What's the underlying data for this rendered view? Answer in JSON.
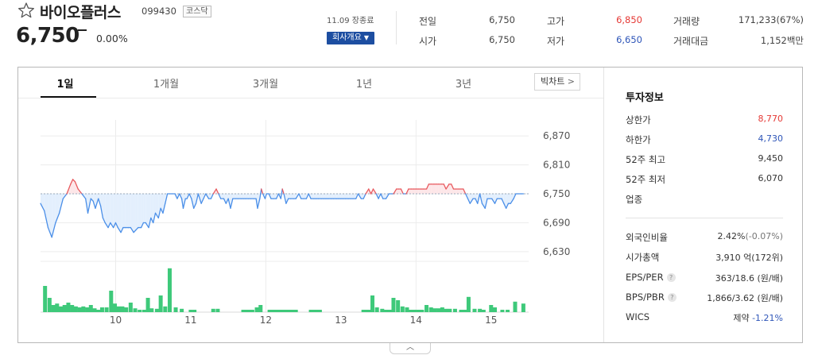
{
  "header": {
    "stock_name": "바이오플러스",
    "stock_code": "099430",
    "market_badge": "코스닥",
    "price": "6,750",
    "change_rate": "0.00%",
    "date_info": "11.09 장종료",
    "company_overview_label": "회사개요"
  },
  "quote": {
    "prev_close_label": "전일",
    "prev_close": "6,750",
    "open_label": "시가",
    "open": "6,750",
    "high_label": "고가",
    "high": "6,850",
    "low_label": "저가",
    "low": "6,650",
    "volume_label": "거래량",
    "volume": "171,233(67%)",
    "amount_label": "거래대금",
    "amount": "1,152백만"
  },
  "tabs": [
    {
      "label": "1일",
      "active": true
    },
    {
      "label": "1개월",
      "active": false
    },
    {
      "label": "3개월",
      "active": false
    },
    {
      "label": "1년",
      "active": false
    },
    {
      "label": "3년",
      "active": false
    }
  ],
  "big_chart_label": "빅차트",
  "chart_data": {
    "type": "line",
    "baseline": 6750,
    "ylim": [
      6620,
      6890
    ],
    "y_ticks": [
      "6,870",
      "6,810",
      "6,750",
      "6,690",
      "6,630"
    ],
    "y_tick_values": [
      6870,
      6810,
      6750,
      6690,
      6630
    ],
    "x_ticks": [
      "10",
      "11",
      "12",
      "13",
      "14",
      "15"
    ],
    "x_tick_hours": [
      10,
      11,
      12,
      13,
      14,
      15
    ],
    "x_range_hours": [
      9.0,
      15.5
    ],
    "x_gridlines_hours": [
      10,
      12,
      14
    ],
    "price_series": [
      [
        9.0,
        6730
      ],
      [
        9.05,
        6715
      ],
      [
        9.1,
        6680
      ],
      [
        9.15,
        6660
      ],
      [
        9.2,
        6690
      ],
      [
        9.25,
        6710
      ],
      [
        9.3,
        6740
      ],
      [
        9.35,
        6750
      ],
      [
        9.4,
        6770
      ],
      [
        9.43,
        6780
      ],
      [
        9.46,
        6775
      ],
      [
        9.5,
        6760
      ],
      [
        9.55,
        6750
      ],
      [
        9.6,
        6740
      ],
      [
        9.63,
        6710
      ],
      [
        9.67,
        6740
      ],
      [
        9.7,
        6735
      ],
      [
        9.73,
        6720
      ],
      [
        9.77,
        6740
      ],
      [
        9.8,
        6725
      ],
      [
        9.83,
        6700
      ],
      [
        9.86,
        6690
      ],
      [
        9.9,
        6680
      ],
      [
        9.93,
        6690
      ],
      [
        9.97,
        6680
      ],
      [
        10.0,
        6690
      ],
      [
        10.03,
        6680
      ],
      [
        10.07,
        6670
      ],
      [
        10.1,
        6680
      ],
      [
        10.13,
        6680
      ],
      [
        10.17,
        6680
      ],
      [
        10.2,
        6680
      ],
      [
        10.24,
        6670
      ],
      [
        10.27,
        6675
      ],
      [
        10.3,
        6680
      ],
      [
        10.34,
        6680
      ],
      [
        10.37,
        6690
      ],
      [
        10.4,
        6690
      ],
      [
        10.44,
        6680
      ],
      [
        10.47,
        6700
      ],
      [
        10.5,
        6690
      ],
      [
        10.53,
        6710
      ],
      [
        10.57,
        6700
      ],
      [
        10.6,
        6720
      ],
      [
        10.63,
        6710
      ],
      [
        10.66,
        6730
      ],
      [
        10.69,
        6750
      ],
      [
        10.72,
        6750
      ],
      [
        10.75,
        6750
      ],
      [
        10.79,
        6750
      ],
      [
        10.82,
        6740
      ],
      [
        10.85,
        6750
      ],
      [
        10.88,
        6740
      ],
      [
        10.9,
        6720
      ],
      [
        10.93,
        6740
      ],
      [
        10.95,
        6740
      ],
      [
        10.98,
        6750
      ],
      [
        11.01,
        6740
      ],
      [
        11.04,
        6720
      ],
      [
        11.07,
        6730
      ],
      [
        11.1,
        6750
      ],
      [
        11.14,
        6730
      ],
      [
        11.17,
        6740
      ],
      [
        11.2,
        6750
      ],
      [
        11.24,
        6740
      ],
      [
        11.27,
        6740
      ],
      [
        11.3,
        6750
      ],
      [
        11.34,
        6760
      ],
      [
        11.37,
        6750
      ],
      [
        11.4,
        6740
      ],
      [
        11.44,
        6740
      ],
      [
        11.47,
        6730
      ],
      [
        11.5,
        6740
      ],
      [
        11.53,
        6720
      ],
      [
        11.56,
        6740
      ],
      [
        11.6,
        6740
      ],
      [
        11.63,
        6740
      ],
      [
        11.67,
        6740
      ],
      [
        11.7,
        6740
      ],
      [
        11.73,
        6740
      ],
      [
        11.77,
        6740
      ],
      [
        11.8,
        6740
      ],
      [
        11.84,
        6740
      ],
      [
        11.87,
        6740
      ],
      [
        11.89,
        6720
      ],
      [
        11.92,
        6740
      ],
      [
        11.94,
        6760
      ],
      [
        11.96,
        6750
      ],
      [
        11.99,
        6740
      ],
      [
        12.01,
        6750
      ],
      [
        12.04,
        6750
      ],
      [
        12.07,
        6740
      ],
      [
        12.1,
        6740
      ],
      [
        12.14,
        6740
      ],
      [
        12.17,
        6750
      ],
      [
        12.2,
        6740
      ],
      [
        12.22,
        6760
      ],
      [
        12.24,
        6750
      ],
      [
        12.27,
        6730
      ],
      [
        12.3,
        6740
      ],
      [
        12.33,
        6740
      ],
      [
        12.37,
        6740
      ],
      [
        12.4,
        6740
      ],
      [
        12.44,
        6750
      ],
      [
        12.47,
        6740
      ],
      [
        12.5,
        6740
      ],
      [
        12.54,
        6740
      ],
      [
        12.57,
        6750
      ],
      [
        12.6,
        6740
      ],
      [
        12.64,
        6740
      ],
      [
        12.67,
        6740
      ],
      [
        12.7,
        6740
      ],
      [
        12.74,
        6740
      ],
      [
        12.77,
        6740
      ],
      [
        12.8,
        6740
      ],
      [
        12.83,
        6740
      ],
      [
        12.87,
        6740
      ],
      [
        12.9,
        6740
      ],
      [
        12.94,
        6740
      ],
      [
        12.97,
        6740
      ],
      [
        13.0,
        6740
      ],
      [
        13.03,
        6740
      ],
      [
        13.06,
        6740
      ],
      [
        13.1,
        6740
      ],
      [
        13.13,
        6740
      ],
      [
        13.16,
        6740
      ],
      [
        13.2,
        6740
      ],
      [
        13.23,
        6750
      ],
      [
        13.27,
        6740
      ],
      [
        13.3,
        6740
      ],
      [
        13.33,
        6750
      ],
      [
        13.37,
        6760
      ],
      [
        13.4,
        6750
      ],
      [
        13.43,
        6760
      ],
      [
        13.47,
        6750
      ],
      [
        13.5,
        6740
      ],
      [
        13.53,
        6750
      ],
      [
        13.56,
        6740
      ],
      [
        13.6,
        6740
      ],
      [
        13.64,
        6750
      ],
      [
        13.67,
        6750
      ],
      [
        13.7,
        6750
      ],
      [
        13.74,
        6760
      ],
      [
        13.77,
        6760
      ],
      [
        13.8,
        6760
      ],
      [
        13.83,
        6750
      ],
      [
        13.87,
        6750
      ],
      [
        13.9,
        6760
      ],
      [
        13.94,
        6760
      ],
      [
        13.97,
        6760
      ],
      [
        14.0,
        6760
      ],
      [
        14.03,
        6760
      ],
      [
        14.07,
        6760
      ],
      [
        14.1,
        6760
      ],
      [
        14.14,
        6760
      ],
      [
        14.17,
        6770
      ],
      [
        14.2,
        6770
      ],
      [
        14.24,
        6770
      ],
      [
        14.27,
        6770
      ],
      [
        14.3,
        6770
      ],
      [
        14.34,
        6770
      ],
      [
        14.37,
        6770
      ],
      [
        14.4,
        6760
      ],
      [
        14.44,
        6770
      ],
      [
        14.47,
        6770
      ],
      [
        14.5,
        6760
      ],
      [
        14.53,
        6760
      ],
      [
        14.57,
        6760
      ],
      [
        14.6,
        6760
      ],
      [
        14.63,
        6760
      ],
      [
        14.66,
        6750
      ],
      [
        14.69,
        6740
      ],
      [
        14.72,
        6730
      ],
      [
        14.76,
        6740
      ],
      [
        14.79,
        6740
      ],
      [
        14.82,
        6730
      ],
      [
        14.85,
        6750
      ],
      [
        14.88,
        6730
      ],
      [
        14.92,
        6720
      ],
      [
        14.95,
        6740
      ],
      [
        14.98,
        6740
      ],
      [
        15.01,
        6740
      ],
      [
        15.05,
        6730
      ],
      [
        15.08,
        6740
      ],
      [
        15.11,
        6740
      ],
      [
        15.14,
        6740
      ],
      [
        15.17,
        6730
      ],
      [
        15.2,
        6720
      ],
      [
        15.23,
        6730
      ],
      [
        15.26,
        6730
      ],
      [
        15.3,
        6740
      ],
      [
        15.33,
        6750
      ],
      [
        15.36,
        6750
      ],
      [
        15.4,
        6750
      ],
      [
        15.43,
        6750
      ]
    ],
    "volume_bars": [
      [
        9.06,
        0.55
      ],
      [
        9.12,
        0.3
      ],
      [
        9.17,
        0.15
      ],
      [
        9.22,
        0.18
      ],
      [
        9.27,
        0.12
      ],
      [
        9.32,
        0.15
      ],
      [
        9.37,
        0.2
      ],
      [
        9.42,
        0.15
      ],
      [
        9.47,
        0.12
      ],
      [
        9.52,
        0.1
      ],
      [
        9.57,
        0.12
      ],
      [
        9.62,
        0.1
      ],
      [
        9.67,
        0.15
      ],
      [
        9.72,
        0.08
      ],
      [
        9.77,
        0.05
      ],
      [
        9.82,
        0.1
      ],
      [
        9.88,
        0.1
      ],
      [
        9.94,
        0.45
      ],
      [
        9.99,
        0.18
      ],
      [
        10.04,
        0.12
      ],
      [
        10.09,
        0.12
      ],
      [
        10.14,
        0.1
      ],
      [
        10.2,
        0.2
      ],
      [
        10.26,
        0.08
      ],
      [
        10.32,
        0.05
      ],
      [
        10.38,
        0.05
      ],
      [
        10.43,
        0.3
      ],
      [
        10.48,
        0.08
      ],
      [
        10.55,
        0.07
      ],
      [
        10.6,
        0.35
      ],
      [
        10.66,
        0.12
      ],
      [
        10.72,
        0.92
      ],
      [
        10.8,
        0.1
      ],
      [
        10.88,
        0.07
      ],
      [
        11.0,
        0.05
      ],
      [
        11.05,
        0.05
      ],
      [
        11.3,
        0.07
      ],
      [
        11.36,
        0.07
      ],
      [
        11.7,
        0.05
      ],
      [
        11.74,
        0.05
      ],
      [
        11.78,
        0.05
      ],
      [
        11.82,
        0.05
      ],
      [
        11.88,
        0.1
      ],
      [
        11.93,
        0.15
      ],
      [
        12.05,
        0.05
      ],
      [
        12.08,
        0.05
      ],
      [
        12.12,
        0.05
      ],
      [
        12.16,
        0.05
      ],
      [
        12.2,
        0.05
      ],
      [
        12.24,
        0.05
      ],
      [
        12.28,
        0.05
      ],
      [
        12.32,
        0.05
      ],
      [
        12.36,
        0.05
      ],
      [
        12.4,
        0.05
      ],
      [
        12.6,
        0.05
      ],
      [
        12.64,
        0.05
      ],
      [
        12.68,
        0.05
      ],
      [
        12.72,
        0.05
      ],
      [
        13.3,
        0.05
      ],
      [
        13.34,
        0.05
      ],
      [
        13.38,
        0.05
      ],
      [
        13.42,
        0.35
      ],
      [
        13.48,
        0.1
      ],
      [
        13.55,
        0.07
      ],
      [
        13.6,
        0.05
      ],
      [
        13.65,
        0.05
      ],
      [
        13.7,
        0.3
      ],
      [
        13.76,
        0.25
      ],
      [
        13.82,
        0.12
      ],
      [
        13.88,
        0.1
      ],
      [
        13.93,
        0.05
      ],
      [
        13.98,
        0.05
      ],
      [
        14.03,
        0.05
      ],
      [
        14.08,
        0.05
      ],
      [
        14.14,
        0.15
      ],
      [
        14.2,
        0.1
      ],
      [
        14.25,
        0.08
      ],
      [
        14.3,
        0.08
      ],
      [
        14.35,
        0.1
      ],
      [
        14.4,
        0.07
      ],
      [
        14.45,
        0.07
      ],
      [
        14.52,
        0.07
      ],
      [
        14.6,
        0.05
      ],
      [
        14.65,
        0.05
      ],
      [
        14.7,
        0.32
      ],
      [
        14.78,
        0.07
      ],
      [
        14.85,
        0.07
      ],
      [
        14.9,
        0.05
      ],
      [
        15.0,
        0.15
      ],
      [
        15.05,
        0.1
      ],
      [
        15.15,
        0.05
      ],
      [
        15.22,
        0.05
      ],
      [
        15.32,
        0.22
      ],
      [
        15.43,
        0.18
      ]
    ],
    "colors": {
      "up": "#e8595e",
      "down": "#4b8fe8",
      "up_fill": "#fde6e8",
      "down_fill": "#e3effd",
      "volume": "#3ec97a",
      "baseline": "#9aa8bb",
      "grid": "#ececec"
    }
  },
  "invest": {
    "title": "투자정보",
    "rows_top": [
      {
        "label": "상한가",
        "value": "8,770",
        "color": "red"
      },
      {
        "label": "하한가",
        "value": "4,730",
        "color": "blue"
      },
      {
        "label": "52주 최고",
        "value": "9,450",
        "color": ""
      },
      {
        "label": "52주 최저",
        "value": "6,070",
        "color": ""
      },
      {
        "label": "업종",
        "value": "",
        "color": ""
      }
    ],
    "foreign_ratio_label": "외국인비율",
    "foreign_ratio": "2.42%",
    "foreign_ratio_change": "(-0.07%)",
    "market_cap_label": "시가총액",
    "market_cap": "3,910 억(172위)",
    "eps_per_label": "EPS/PER",
    "eps_per": "363/18.6 (원/배)",
    "bps_pbr_label": "BPS/PBR",
    "bps_pbr": "1,866/3.62 (원/배)",
    "wics_label": "WICS",
    "wics_sector": "제약",
    "wics_change": "-1.21%",
    "hint_glyph": "?"
  },
  "collapse_icon": "chevron-up-icon"
}
